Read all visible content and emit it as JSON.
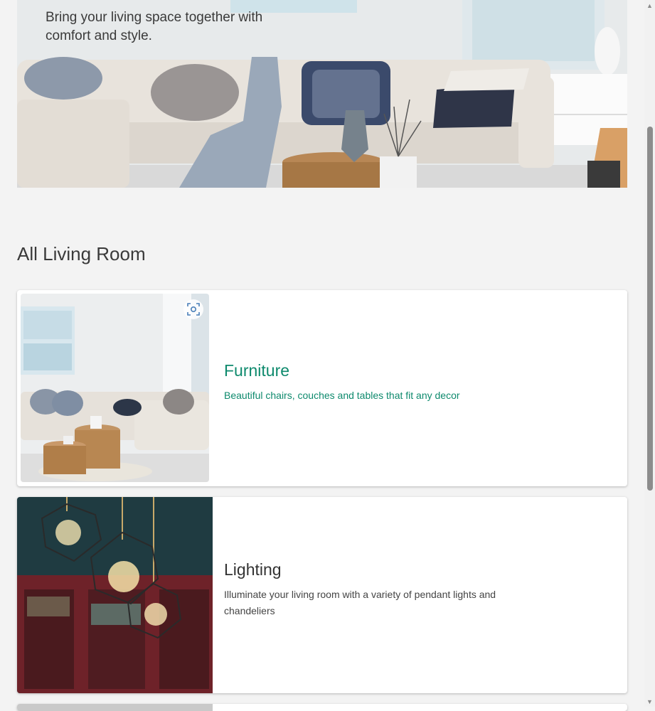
{
  "hero": {
    "subtitle": "Bring your living space together with comfort and style."
  },
  "section": {
    "title": "All Living Room"
  },
  "cards": [
    {
      "title": "Furniture",
      "description": "Beautiful chairs, couches and tables that fit any decor",
      "accent": "#0e8a6d",
      "lens_icon": "visual-search-icon"
    },
    {
      "title": "Lighting",
      "description": "Illuminate your living room with a variety of pendant lights and chandeliers"
    }
  ],
  "scrollbar": {
    "up_icon": "▲",
    "down_icon": "▼"
  }
}
